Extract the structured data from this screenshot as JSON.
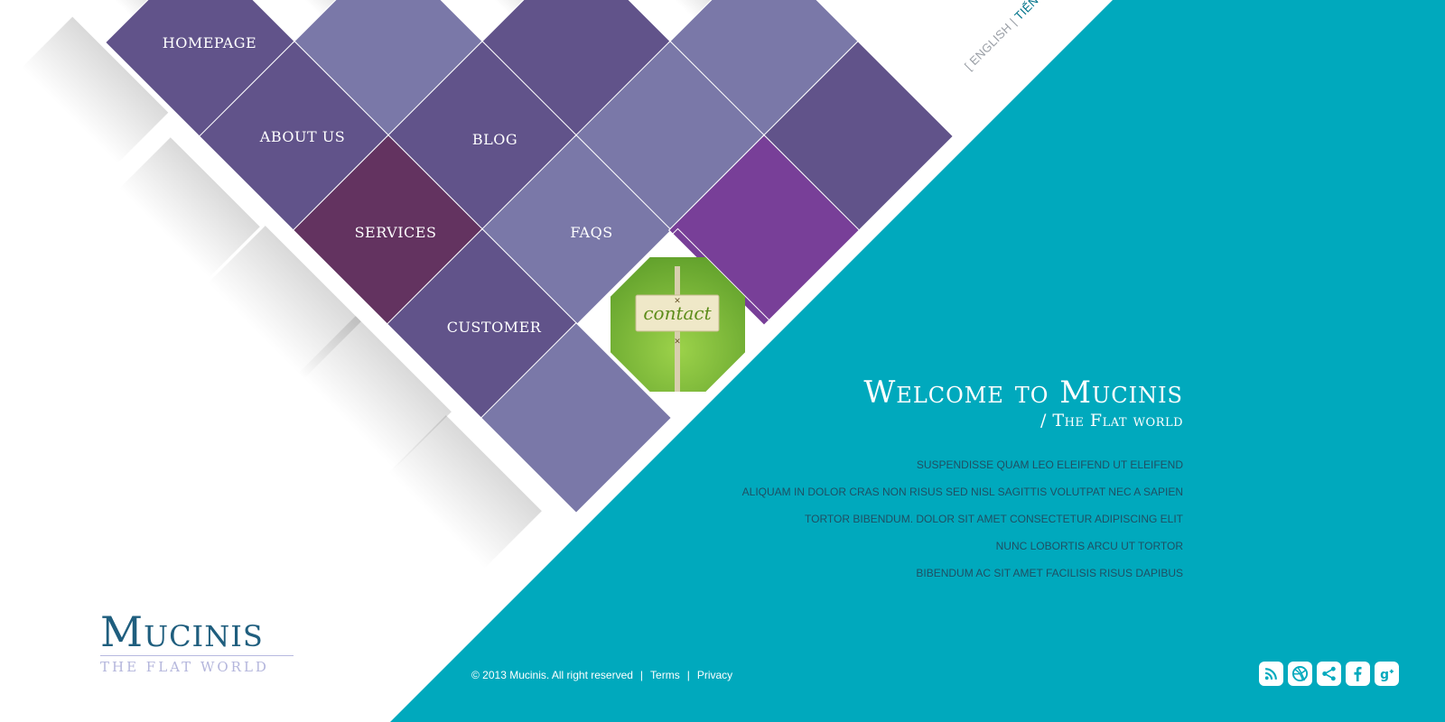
{
  "nav": {
    "homepage": "HOMEPAGE",
    "about_us": "ABOUT US",
    "blog": "BLOG",
    "services": "SERVICES",
    "faqs": "FAQS",
    "customer": "CUSTOMER",
    "contact": "contact"
  },
  "language": {
    "open_bracket": "[",
    "english": "ENGLISH",
    "separator": "|",
    "vietnamese": "TIẾNG VIỆT",
    "close_bracket": "]",
    "active": "vietnamese"
  },
  "welcome": {
    "title": "Welcome to Mucinis",
    "subtitle": "/ The Flat world"
  },
  "text_lines": [
    "SUSPENDISSE QUAM LEO ELEIFEND UT ELEIFEND",
    "ALIQUAM IN DOLOR CRAS NON RISUS SED NISL SAGITTIS VOLUTPAT NEC A SAPIEN",
    "TORTOR BIBENDUM. DOLOR SIT AMET CONSECTETUR ADIPISCING ELIT",
    "NUNC LOBORTIS ARCU UT TORTOR",
    "BIBENDUM AC  SIT AMET FACILISIS RISUS DAPIBUS"
  ],
  "logo": {
    "name": "Mucinis",
    "tagline": "THE FLAT WORLD"
  },
  "footer": {
    "copyright": "© 2013 Mucinis. All right reserved",
    "separator": "|",
    "terms": "Terms",
    "privacy": "Privacy"
  },
  "social": [
    "rss-icon",
    "dribbble-icon",
    "share-icon",
    "facebook-icon",
    "google-plus-icon"
  ],
  "colors": {
    "teal": "#00a9bd",
    "purple_dark": "#61538a",
    "purple_light": "#7a78a8",
    "plum": "#633360",
    "violet": "#783f98",
    "logo_blue": "#1f5e7e",
    "text_dark": "#1f4f63"
  }
}
